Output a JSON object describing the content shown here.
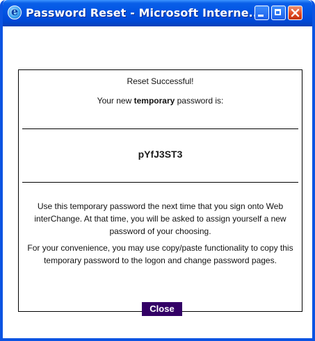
{
  "window": {
    "title": "Password Reset - Microsoft Interne..."
  },
  "message": {
    "status": "Reset Successful!",
    "intro_prefix": "Your new ",
    "intro_bold": "temporary",
    "intro_suffix": " password is:",
    "temporary_password": "pYfJ3ST3",
    "paragraph1": "Use this temporary password the next time that you sign onto Web interChange. At that time, you will be asked to assign yourself a new password of your choosing.",
    "paragraph2": "For your convenience, you may use copy/paste functionality to copy this temporary password to the logon and change password pages."
  },
  "actions": {
    "close_label": "Close"
  },
  "colors": {
    "titlebar": "#0054e3",
    "close_button_bg": "#330066",
    "close_button_text": "#ffffff"
  }
}
